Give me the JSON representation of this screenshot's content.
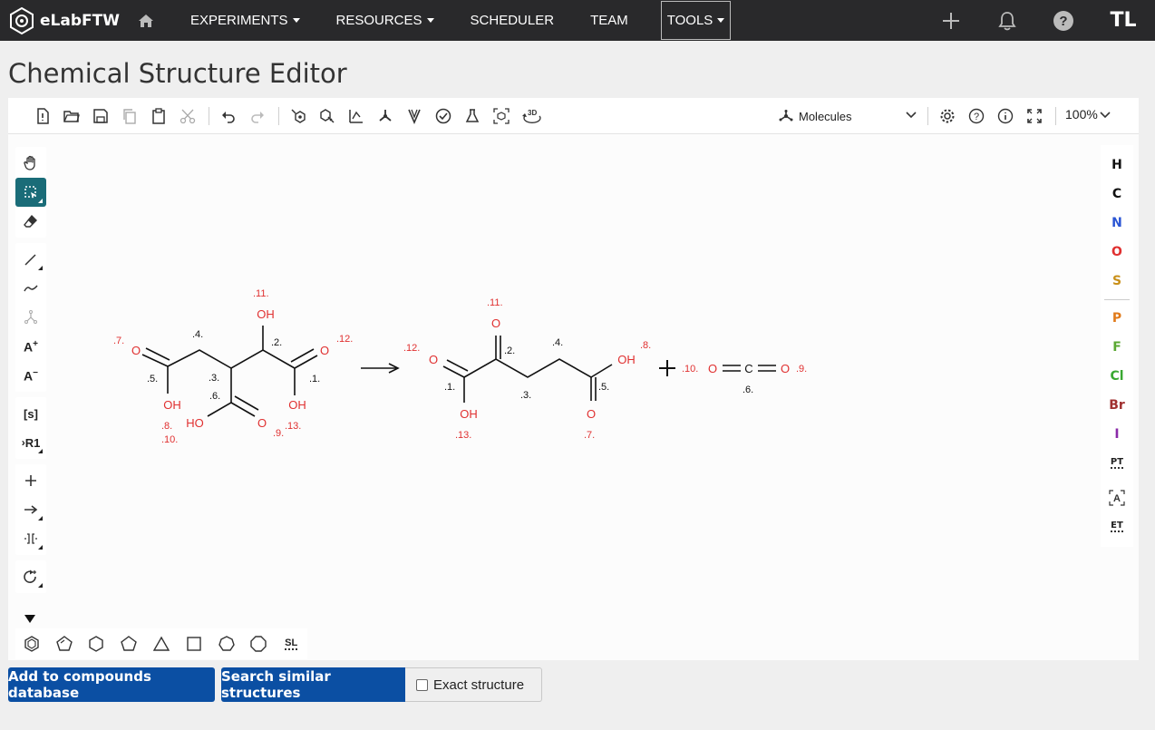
{
  "nav": {
    "brand": "eLabFTW",
    "items": [
      "EXPERIMENTS",
      "RESOURCES",
      "SCHEDULER",
      "TEAM",
      "TOOLS"
    ],
    "avatar": "TL"
  },
  "page": {
    "title": "Chemical Structure Editor"
  },
  "editor": {
    "mode": "Molecules",
    "zoom": "100%",
    "atoms": [
      "H",
      "C",
      "N",
      "O",
      "S",
      "P",
      "F",
      "Cl",
      "Br",
      "I"
    ],
    "atom_colors": {
      "H": "#111111",
      "C": "#111111",
      "N": "#2a55d4",
      "O": "#e03030",
      "S": "#c9901a",
      "P": "#e07a1a",
      "F": "#5aa832",
      "Cl": "#3aa832",
      "Br": "#a03030",
      "I": "#8a2aa8"
    },
    "extra_atoms": [
      "PT",
      "ET"
    ],
    "left_text_tools": [
      "[s]",
      "R1"
    ],
    "shape_last": "SL"
  },
  "reaction": {
    "reactant": {
      "labels": {
        "o_left": "O",
        "oh_bottom_left": "OH",
        "oh_top": "OH",
        "o_right": "O",
        "oh_bottom_right": "OH",
        "ho_center": "HO",
        "o_center": "O"
      },
      "indices": [
        ".1.",
        ".2.",
        ".3.",
        ".4.",
        ".5.",
        ".6.",
        ".7.",
        ".8.",
        ".9.",
        ".10.",
        ".11.",
        ".12.",
        ".13."
      ]
    },
    "product": {
      "labels": {
        "o_top": "O",
        "o_left": "O",
        "oh_bottom": "OH",
        "oh_right": "OH",
        "o_bottom": "O"
      },
      "indices": [
        ".1.",
        ".2.",
        ".3.",
        ".4.",
        ".5.",
        ".7.",
        ".8.",
        ".11.",
        ".12.",
        ".13."
      ]
    },
    "co2": {
      "labels": {
        "o_left": "O",
        "c": "C",
        "o_right": "O"
      },
      "indices": [
        ".6.",
        ".9.",
        ".10."
      ]
    },
    "plus": "+"
  },
  "actions": {
    "add_compound": "Add to compounds database",
    "search_similar": "Search similar structures",
    "exact_structure": "Exact structure"
  }
}
